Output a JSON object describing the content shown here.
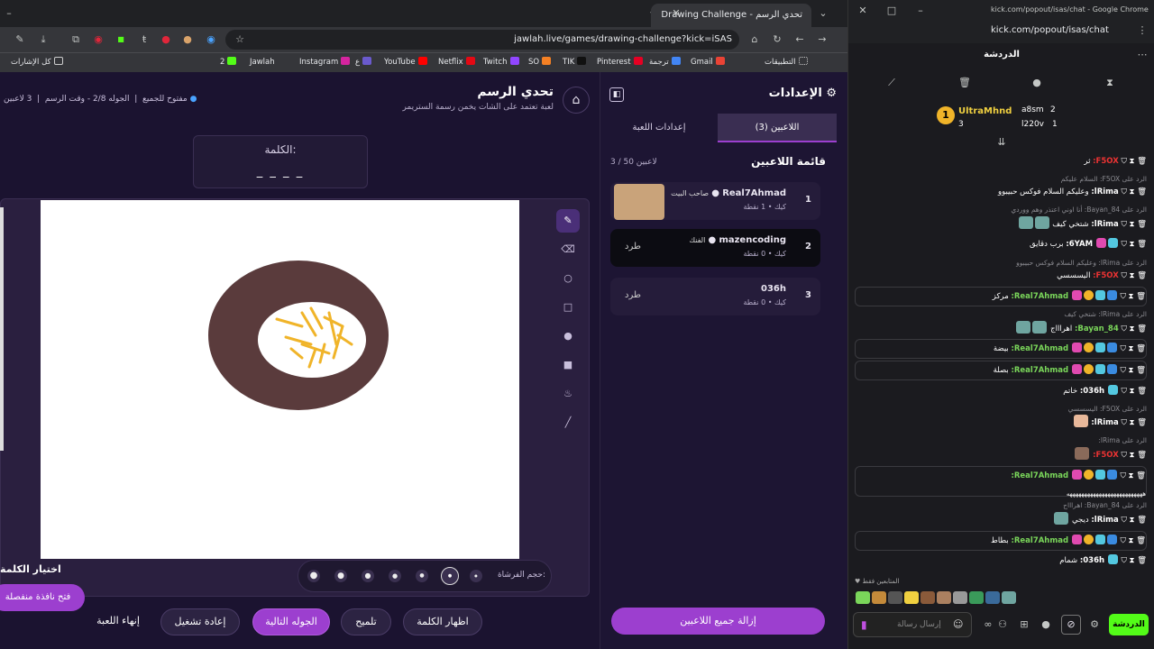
{
  "browser": {
    "tab_title": "Drawing Challenge - تحدي الرسم",
    "url": "jawlah.live/games/drawing-challenge?kick=iSAS"
  },
  "bookmarks": [
    "كل الإشارات",
    "2",
    "Jawlah",
    "Instagram",
    "ع",
    "YouTube",
    "Netflix",
    "Twitch",
    "SO",
    "TIK",
    "Pinterest",
    "ترجمة",
    "Gmail",
    "التطبيقات"
  ],
  "game": {
    "title": "تحدي الرسم",
    "subtitle": "لعبة تعتمد على الشات يخمن رسمة الستريمر",
    "status_players": "3 لاعبين",
    "status_round": "الجوله 2/8 - وقت الرسم",
    "status_open": "مفتوح للجميع",
    "word_label": "الكلمة:",
    "word_mask": "_ _ _ _",
    "brush_label": "حجم الفرشاة:",
    "choose_word": "اختيار الكلمة",
    "open_popup": "فتح نافذة منفصلة"
  },
  "actions": {
    "end": "إنهاء اللعبة",
    "restart": "إعادة تشغيل",
    "next_round": "الجوله التالية",
    "hint": "تلميح",
    "show_word": "اظهار الكلمة"
  },
  "settings": {
    "title": "الإعدادات",
    "tab_players": "اللاعبين (3)",
    "tab_game": "إعدادات اللعبة",
    "list_title": "قائمة اللاعبين",
    "count": "3 / 50 لاعبين",
    "remove_all": "إزالة جميع اللاعبين"
  },
  "players": [
    {
      "rank": "1",
      "name": "Real7Ahmad",
      "tag": "صاحب البيت",
      "sub": "كيك • 1 نقطة",
      "kick": ""
    },
    {
      "rank": "2",
      "name": "mazencoding",
      "tag": "الفنك",
      "sub": "كيك • 0 نقطة",
      "kick": "طرد"
    },
    {
      "rank": "3",
      "name": "036h",
      "tag": "",
      "sub": "كيك • 0 نقطة",
      "kick": "طرد"
    }
  ],
  "chat": {
    "window_title": "kick.com/popout/isas/chat - Google Chrome",
    "url": "kick.com/popout/isas/chat",
    "title": "الدردشة",
    "top_users": [
      {
        "name": "UltraMhnd",
        "count": "3"
      },
      {
        "name": "a8sm",
        "count": "2"
      },
      {
        "name": "l220v",
        "count": "1"
      }
    ],
    "messages": [
      {
        "user": "F5OX:",
        "text": "ثر",
        "reply": ""
      },
      {
        "user": "lRima:",
        "text": "وعليكم السلام فوكس حبيبوو",
        "reply": "الرد على F5OX: السلام عليكم"
      },
      {
        "user": "lRima:",
        "text": "شتخي كيف",
        "reply": "الرد على Bayan_84: أنا اوني اعتذر وهم ووردي"
      },
      {
        "user": "6YAM:",
        "text": "برب دقايق",
        "reply": ""
      },
      {
        "user": "F5OX:",
        "text": "اليسسسي",
        "reply": "الرد على lRima: وعليكم السلام فوكس حبيبوو"
      },
      {
        "user": "Real7Ahmad:",
        "text": "مركز",
        "reply": ""
      },
      {
        "user": "Bayan_84:",
        "text": "اهراااج",
        "reply": "الرد على lRima: شتخي كيف"
      },
      {
        "user": "Real7Ahmad:",
        "text": "بيضة",
        "reply": ""
      },
      {
        "user": "Real7Ahmad:",
        "text": "بصلة",
        "reply": ""
      },
      {
        "user": "036h:",
        "text": "خاتم",
        "reply": ""
      },
      {
        "user": "lRima:",
        "text": "",
        "reply": "الرد على F5OX: اليسسسي"
      },
      {
        "user": "F5OX:",
        "text": "",
        "reply": "الرد على lRima:"
      },
      {
        "user": "Real7Ahmad:",
        "text": "ههههههههههههههههههههههههههه",
        "reply": ""
      },
      {
        "user": "lRima:",
        "text": "ديجي",
        "reply": "الرد على Bayan_84: اهراااج"
      },
      {
        "user": "Real7Ahmad:",
        "text": "بطاط",
        "reply": ""
      },
      {
        "user": "036h:",
        "text": "شمام",
        "reply": ""
      }
    ],
    "followers_label": "المتابعين فقط",
    "input_placeholder": "إرسال رسالة",
    "send": "الدردشة"
  }
}
